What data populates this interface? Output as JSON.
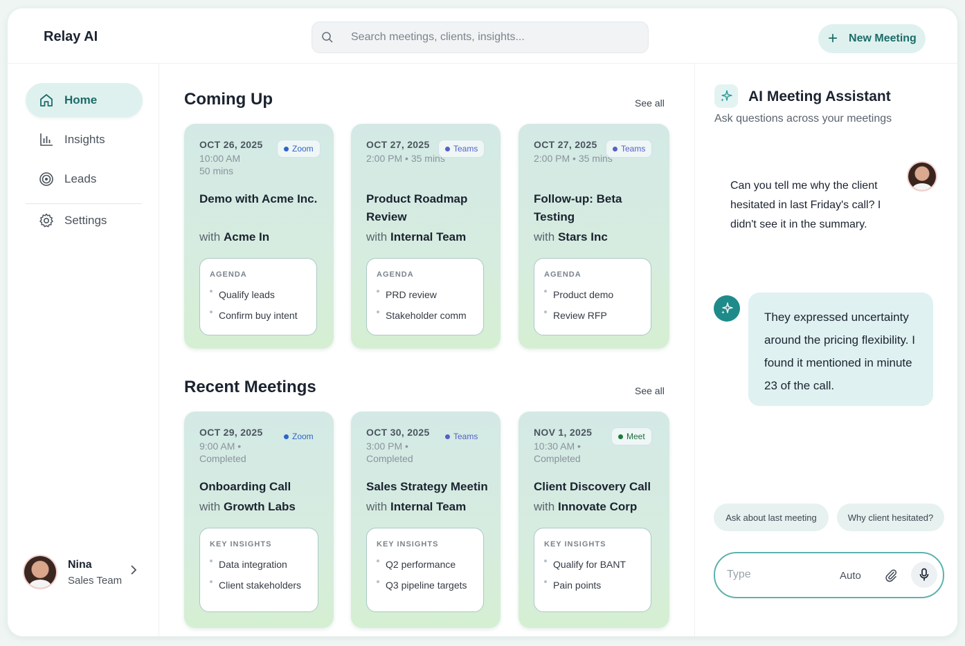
{
  "app": {
    "brand": "Relay AI"
  },
  "search": {
    "placeholder": "Search meetings, clients, insights..."
  },
  "header": {
    "new_meeting_label": "New Meeting",
    "new_meeting_icon": "plus-icon"
  },
  "sidebar": {
    "items": [
      {
        "label": "Home",
        "icon": "home-icon",
        "active": true
      },
      {
        "label": "Insights",
        "icon": "bar-chart-icon",
        "active": false
      },
      {
        "label": "Leads",
        "icon": "target-icon",
        "active": false
      },
      {
        "label": "Settings",
        "icon": "gear-icon",
        "active": false
      }
    ],
    "user": {
      "name": "Nina",
      "team": "Sales Team"
    }
  },
  "upcoming": {
    "title": "Coming Up",
    "see_all": "See all",
    "cards": [
      {
        "date": "OCT 26, 2025",
        "meta": "10:00 AM\n50 mins",
        "platform": "Zoom",
        "title": "Demo with Acme Inc.",
        "with_word": "with",
        "client": "Acme In",
        "box_label": "AGENDA",
        "items": [
          "Qualify leads",
          "Confirm buy intent"
        ]
      },
      {
        "date": "OCT 27, 2025",
        "meta": "2:00 PM • 35 mins",
        "platform": "Teams",
        "title": "Product Roadmap Review",
        "with_word": "with",
        "client": "Internal Team",
        "box_label": "AGENDA",
        "items": [
          "PRD review",
          "Stakeholder comm"
        ]
      },
      {
        "date": "OCT 27, 2025",
        "meta": "2:00 PM • 35 mins",
        "platform": "Teams",
        "title": "Follow-up: Beta Testing",
        "with_word": "with",
        "client": "Stars Inc",
        "box_label": "AGENDA",
        "items": [
          "Product demo",
          "Review RFP"
        ]
      }
    ]
  },
  "recent": {
    "title": "Recent Meetings",
    "see_all": "See all",
    "cards": [
      {
        "date": "OCT 29, 2025",
        "meta": "9:00 AM • Completed",
        "platform": "Zoom",
        "title": "Onboarding Call",
        "with_word": "with",
        "client": "Growth Labs",
        "box_label": "KEY INSIGHTS",
        "items": [
          "Data integration",
          "Client stakeholders"
        ]
      },
      {
        "date": "OCT 30, 2025",
        "meta": "3:00 PM • Completed",
        "platform": "Teams",
        "title": "Sales Strategy Meetin",
        "with_word": "with",
        "client": "Internal Team",
        "box_label": "KEY INSIGHTS",
        "items": [
          "Q2 performance",
          "Q3 pipeline targets"
        ]
      },
      {
        "date": "NOV 1, 2025",
        "meta": "10:30 AM • Completed",
        "platform": "Meet",
        "title": "Client Discovery Call",
        "with_word": "with",
        "client": "Innovate Corp",
        "box_label": "KEY INSIGHTS",
        "items": [
          "Qualify for BANT",
          "Pain points"
        ]
      }
    ]
  },
  "assistant": {
    "title": "AI Meeting Assistant",
    "subtitle": "Ask questions across your meetings",
    "icon": "sparkle-icon",
    "question": "Can you tell me why the client hesitated in last Friday's call? I didn't see it in the summary.",
    "answer": "They expressed uncertainty around the pricing flexibility. I found it mentioned in minute 23 of the call.",
    "chips": [
      "Ask about last meeting",
      "Why client hesitated?"
    ],
    "composer": {
      "placeholder": "Type",
      "mode": "Auto"
    }
  },
  "colors": {
    "accent": "#1b6c68",
    "accent_bg": "#dff1ef",
    "bot": "#1e8b8a"
  }
}
